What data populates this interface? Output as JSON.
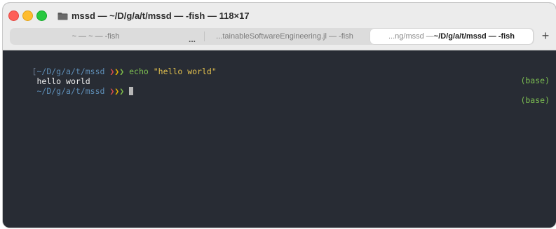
{
  "window": {
    "title": "mssd — ~/D/g/a/t/mssd — -fish — 118×17"
  },
  "tabs": [
    {
      "label": "~ — ~ — -fish"
    },
    {
      "label": "...tainableSoftwareEngineering.jl — -fish"
    },
    {
      "label_prefix": "...ng/mssd — ",
      "label_main": "~/D/g/a/t/mssd — -fish"
    }
  ],
  "tab_overflow": "...",
  "new_tab_label": "+",
  "terminal": {
    "lines": [
      {
        "bracket": "[",
        "path": "~/D/g/a/t/mssd",
        "arrows": [
          "❯",
          "❯",
          "❯"
        ],
        "command": "echo",
        "argument": "\"hello world\"",
        "right": "(base)"
      },
      {
        "output": "hello world"
      },
      {
        "path": "~/D/g/a/t/mssd",
        "arrows": [
          "❯",
          "❯",
          "❯"
        ],
        "right": "(base)"
      }
    ]
  },
  "colors": {
    "background": "#282c34",
    "path": "#5f8fb8",
    "command": "#7dbf52",
    "string": "#e2c04e"
  }
}
